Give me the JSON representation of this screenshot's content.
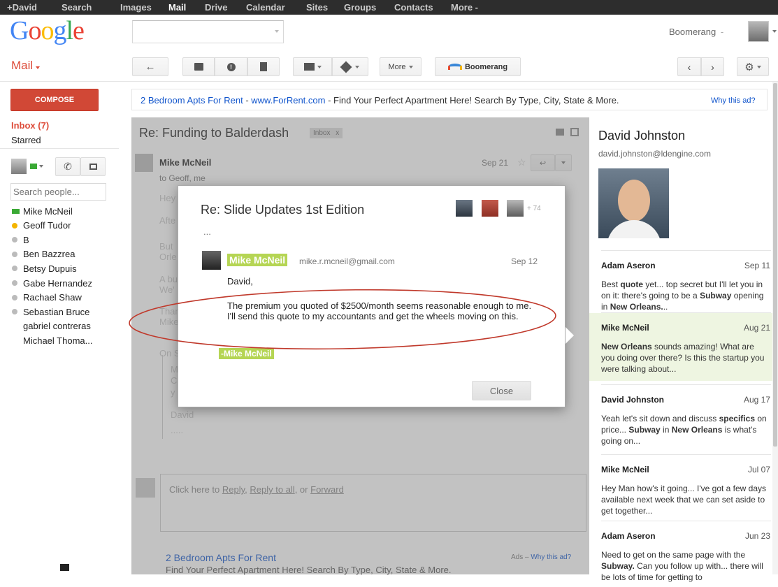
{
  "topnav": {
    "items": [
      "+David",
      "Search",
      "Images",
      "Mail",
      "Drive",
      "Calendar",
      "Sites",
      "Groups",
      "Contacts",
      "More -"
    ]
  },
  "header": {
    "logo": "Google",
    "search_value": "",
    "account_menu": "Boomerang",
    "account_caret": "-"
  },
  "mail_label": "Mail",
  "toolbar": {
    "more_label": "More",
    "boomerang_label": "Boomerang"
  },
  "sidebar": {
    "compose_label": "COMPOSE",
    "inbox_label": "Inbox (7)",
    "starred_label": "Starred",
    "search_people_placeholder": "Search people...",
    "contacts": [
      {
        "name": "Mike McNeil",
        "status": "video"
      },
      {
        "name": "Geoff Tudor",
        "status": "away"
      },
      {
        "name": "B",
        "status": "offline"
      },
      {
        "name": "Ben Bazzrea",
        "status": "offline"
      },
      {
        "name": "Betsy Dupuis",
        "status": "offline"
      },
      {
        "name": "Gabe Hernandez",
        "status": "offline"
      },
      {
        "name": "Rachael Shaw",
        "status": "offline"
      },
      {
        "name": "Sebastian Bruce",
        "status": "offline"
      },
      {
        "name": "gabriel contreras",
        "status": "none"
      },
      {
        "name": "Michael Thoma...",
        "status": "none"
      }
    ]
  },
  "ad_banner": {
    "link": "2 Bedroom Apts For Rent",
    "url": "www.ForRent.com",
    "text": "Find Your Perfect Apartment Here! Search By Type, City, State & More.",
    "why": "Why this ad?"
  },
  "thread": {
    "subject": "Re: Funding to Balderdash",
    "label": "Inbox",
    "label_close": "x",
    "sender": "Mike McNeil",
    "date": "Sep 21",
    "to_line": "to Geoff, me",
    "faded_lines": [
      "Hey",
      "Afte",
      "But",
      "Orle",
      "A bu",
      "We'",
      "Than",
      "Mike",
      "On S",
      "M",
      "C",
      "y",
      "David",
      "....."
    ],
    "reply_prompt_prefix": "Click here to",
    "reply_link": "Reply",
    "reply_all_link": "Reply to all",
    "or_text": ", or",
    "forward_link": "Forward",
    "ad_bottom_title": "2 Bedroom Apts For Rent",
    "ad_bottom_text": "Find Your Perfect Apartment Here! Search By Type, City, State & More.",
    "ad_bottom_label": "Ads –",
    "ad_bottom_why": "Why this ad?"
  },
  "modal": {
    "title": "Re: Slide Updates 1st Edition",
    "participant_count": "+ 74",
    "ellipsis": "...",
    "sender": "Mike McNeil",
    "email": "mike.r.mcneil@gmail.com",
    "date": "Sep 12",
    "greeting": "David,",
    "body": "The premium you quoted of $2500/month seems reasonable enough to me. I'll send this quote to my accountants and get the wheels moving on this.",
    "signature": "-Mike McNeil",
    "close_label": "Close"
  },
  "contact_panel": {
    "name": "David Johnston",
    "email": "david.johnston@ldengine.com",
    "threads": [
      {
        "sender": "Adam Aseron",
        "date": "Sep 11",
        "snippet_parts": [
          [
            "Best ",
            false
          ],
          [
            "quote",
            true
          ],
          [
            " yet... top secret but I'll let you in on it: there's going to be a ",
            false
          ],
          [
            "Subway",
            true
          ],
          [
            " opening in ",
            false
          ],
          [
            "New Orleans.",
            true
          ],
          [
            "..",
            false
          ]
        ],
        "highlighted": false
      },
      {
        "sender": "Mike McNeil",
        "date": "Aug 21",
        "snippet_parts": [
          [
            "New Orleans",
            true
          ],
          [
            " sounds amazing! What are you doing over there? Is this the startup you were talking about...",
            false
          ]
        ],
        "highlighted": true
      },
      {
        "sender": "David Johnston",
        "date": "Aug 17",
        "snippet_parts": [
          [
            "Yeah let's sit down and discuss ",
            false
          ],
          [
            "specifics",
            true
          ],
          [
            " on price... ",
            false
          ],
          [
            "Subway",
            true
          ],
          [
            " in ",
            false
          ],
          [
            "New Orleans",
            true
          ],
          [
            " is what's going on...",
            false
          ]
        ],
        "highlighted": false
      },
      {
        "sender": "Mike McNeil",
        "date": "Jul 07",
        "snippet_parts": [
          [
            "Hey Man how's it going... I've got a few days available next week that we can set aside to get together...",
            false
          ]
        ],
        "highlighted": false
      },
      {
        "sender": "Adam Aseron",
        "date": "Jun 23",
        "snippet_parts": [
          [
            "Need to get on the same page with the ",
            false
          ],
          [
            "Subway.",
            true
          ],
          [
            " Can you follow up with... there will be lots of time for getting to",
            false
          ]
        ],
        "highlighted": false
      }
    ]
  },
  "colors": {
    "mail_red": "#dd4b39",
    "compose_red": "#d14836",
    "highlight_green": "#b5d554",
    "annotation_red": "#c0392b",
    "ad_link_blue": "#1155cc"
  }
}
